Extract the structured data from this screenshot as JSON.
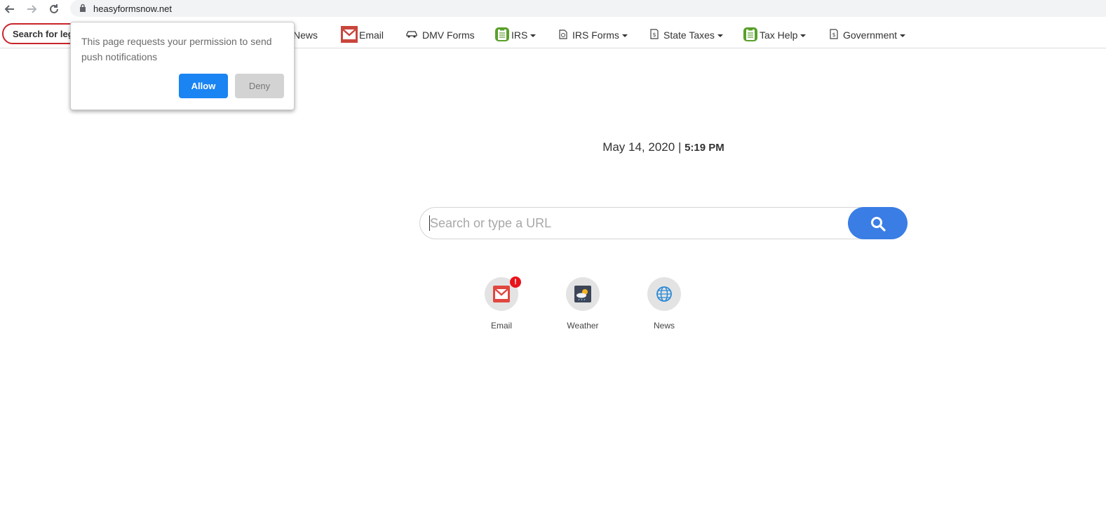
{
  "browser": {
    "url": "heasyformsnow.net"
  },
  "toolbar": {
    "search_label": "Search for leg",
    "items": [
      {
        "label": "News",
        "icon": "news-icon"
      },
      {
        "label": "Email",
        "icon": "email-icon"
      },
      {
        "label": "DMV Forms",
        "icon": "car-icon"
      },
      {
        "label": "IRS",
        "icon": "clipboard-icon",
        "dropdown": true
      },
      {
        "label": "IRS Forms",
        "icon": "form-icon",
        "dropdown": true
      },
      {
        "label": "State Taxes",
        "icon": "tax-icon",
        "dropdown": true
      },
      {
        "label": "Tax Help",
        "icon": "clipboard-icon",
        "dropdown": true
      },
      {
        "label": "Government",
        "icon": "tax-icon",
        "dropdown": true
      }
    ]
  },
  "popup": {
    "message": "This page requests your permission to send push notifications",
    "allow_label": "Allow",
    "deny_label": "Deny"
  },
  "main": {
    "date": "May 14, 2020",
    "separator": "|",
    "time": "5:19 PM",
    "search_placeholder": "Search or type a URL",
    "tiles": [
      {
        "label": "Email",
        "icon": "email-icon",
        "badge": "!"
      },
      {
        "label": "Weather",
        "icon": "weather-icon"
      },
      {
        "label": "News",
        "icon": "globe-icon"
      }
    ]
  },
  "colors": {
    "accent": "#3a7de5",
    "allow_button": "#1a84f2",
    "search_border": "#c9252c",
    "badge": "#e8141c"
  }
}
